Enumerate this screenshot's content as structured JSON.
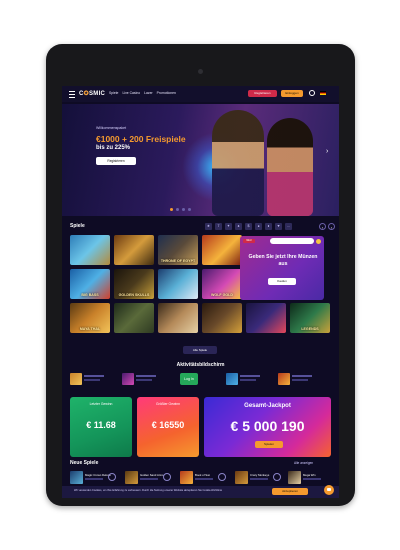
{
  "nav": {
    "logo_main": "C",
    "logo_accent": "SMIC",
    "links": [
      "Spiele",
      "Live Casino",
      "Lazer",
      "Promotionen"
    ],
    "register_label": "Registrieren",
    "login_label": "Einloggen"
  },
  "hero": {
    "kicker": "Willkommenspaket",
    "title": "€1000 + 200 Freispiele",
    "subtitle": "bis zu 225%",
    "cta_label": "Registrieren"
  },
  "games": {
    "title": "Spiele",
    "tiles": [
      {
        "label": ""
      },
      {
        "label": ""
      },
      {
        "label": "THRONE OF EGYPT"
      },
      {
        "label": ""
      },
      {
        "label": "BIG BASS"
      },
      {
        "label": "GOLDEN SKULLS"
      },
      {
        "label": ""
      },
      {
        "label": "WOLF GOLD"
      },
      {
        "label": "MAYA THAL"
      },
      {
        "label": ""
      },
      {
        "label": ""
      },
      {
        "label": ""
      },
      {
        "label": ""
      },
      {
        "label": "LEGENDS"
      }
    ],
    "more_label": "Alle Spiele"
  },
  "promo": {
    "badge": "NEU",
    "text": "Geben Sie jetzt Ihre Münzen aus",
    "cta_label": "Kaufen"
  },
  "activity": {
    "title": "Aktivitätsbildschirm",
    "login_chip": "Log In"
  },
  "jackpots": [
    {
      "caption": "Letzter Gewinn",
      "amount": "€ 11.68",
      "sub": ""
    },
    {
      "caption": "Größter Gewinn",
      "amount": "€ 16550",
      "sub": ""
    },
    {
      "caption": "Gesamt-Jackpot",
      "amount": "€ 5 000 190",
      "cta_label": "Spielen"
    }
  ],
  "new_games": {
    "title": "Neue Spiele",
    "see_all": "Alle anzeigen",
    "items": [
      {
        "name": "Magic Crown Deluxe"
      },
      {
        "name": "Golden Sand Arms"
      },
      {
        "name": "Book of Sun"
      },
      {
        "name": "Crazy Monkeys"
      },
      {
        "name": "Mega Win"
      }
    ]
  },
  "cookie": {
    "text": "Wir verwenden Cookies, um Ihre Erfahrung zu verbessern. Durch die Nutzung unserer Website akzeptieren Sie Cookie-Richtlinie",
    "accept_label": "Akzeptieren"
  },
  "colors": {
    "accent": "#f59a2e",
    "register": "#d02a49",
    "background": "#0e0b24"
  }
}
